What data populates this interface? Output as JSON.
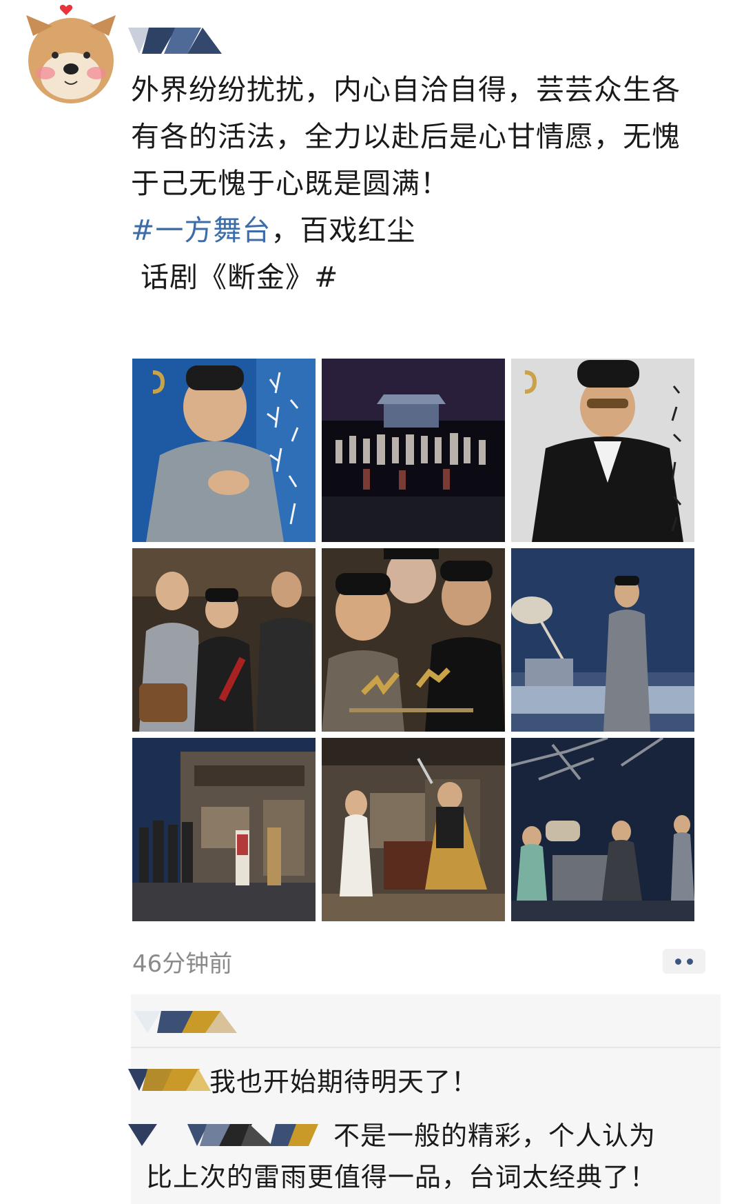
{
  "post": {
    "lines": [
      "外界纷纷扰扰，内心自洽自得，芸芸众生各",
      "有各的活法，全力以赴后是心甘情愿，无愧",
      "于己无愧于心既是圆满！"
    ],
    "hashtag_part": "#一方舞台",
    "after_hashtag": "，百戏红尘",
    "line5_prefix": " 话剧《断金》",
    "line5_suffix": "#",
    "time": "46分钟前"
  },
  "photos": [
    {
      "icon": "poster-actor-gray-robe-blue"
    },
    {
      "icon": "stage-curtain-call"
    },
    {
      "icon": "poster-actor-black-coat"
    },
    {
      "icon": "stage-three-actors"
    },
    {
      "icon": "poster-duan-jin-title"
    },
    {
      "icon": "stage-actor-well"
    },
    {
      "icon": "stage-street-scene"
    },
    {
      "icon": "stage-shop-scene"
    },
    {
      "icon": "stage-tree-well-night"
    }
  ],
  "comments": [
    {
      "text": "我也开始期待明天了！"
    },
    {
      "text_line1": "不是一般的精彩，个人认为",
      "text_line2": "比上次的雷雨更值得一品，台词太经典了！"
    }
  ],
  "colors": {
    "hashtag": "#3d6da8",
    "time": "#8a8a8a",
    "comment_bg": "#f6f6f6"
  }
}
